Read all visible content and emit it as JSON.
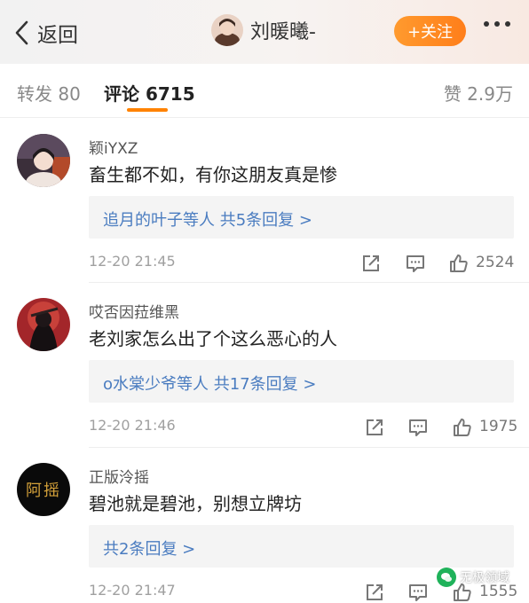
{
  "header": {
    "back_label": "返回",
    "username": "刘暖曦-",
    "follow_label": "+关注"
  },
  "tabs": {
    "forward": "转发 80",
    "comments": "评论 6715",
    "likes": "赞 2.9万"
  },
  "comments": [
    {
      "author": "颖iYXZ",
      "text": "畜生都不如，有你这朋友真是惨",
      "replies": "追月的叶子等人  共5条回复 >",
      "time": "12-20 21:45",
      "likes": "2524"
    },
    {
      "author": "哎否因菈维黑",
      "text": "老刘家怎么出了个这么恶心的人",
      "replies": "o水棠少爷等人  共17条回复 >",
      "time": "12-20 21:46",
      "likes": "1975"
    },
    {
      "author": "正版泠摇",
      "text": "碧池就是碧池，别想立牌坊",
      "replies": "共2条回复 >",
      "time": "12-20 21:47",
      "likes": "1555",
      "avatar_text": "阿摇"
    }
  ],
  "watermark": "无极领域",
  "colors": {
    "accent": "#ff8200",
    "link": "#4a7cc0",
    "follow": "#ff8a24"
  }
}
